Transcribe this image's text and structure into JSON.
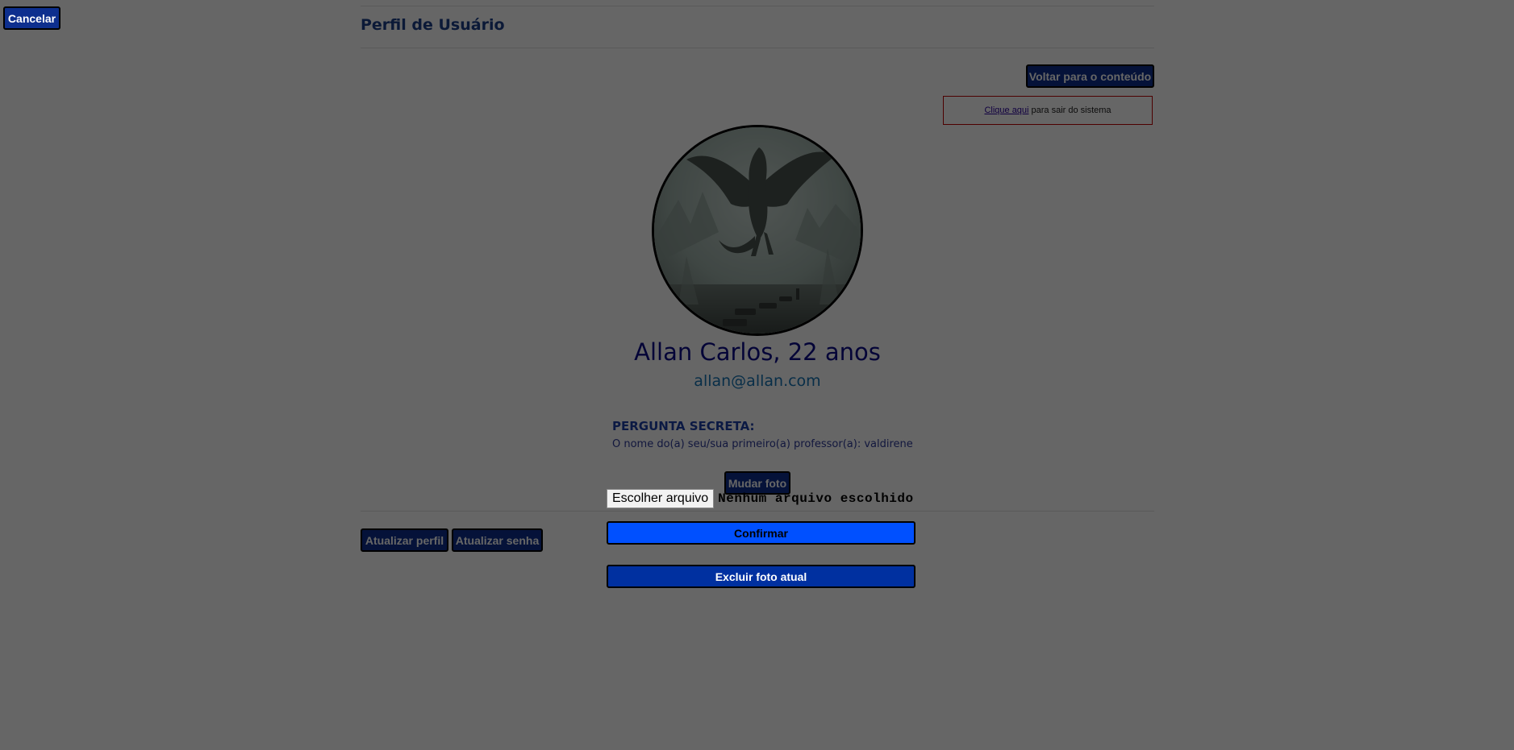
{
  "cancel_label": "Cancelar",
  "header": {
    "title": "Perfil de Usuário"
  },
  "nav": {
    "back_label": "Voltar para o conteúdo"
  },
  "logout": {
    "link_text": "Clique aqui",
    "rest_text": "para sair do sistema"
  },
  "profile": {
    "name_age": "Allan Carlos, 22 anos",
    "email": "allan@allan.com",
    "secret_question_label": "PERGUNTA SECRETA:",
    "secret_question_text": "O nome do(a) seu/sua primeiro(a) professor(a): valdirene"
  },
  "photo": {
    "change_label": "Mudar foto",
    "choose_file_label": "Escolher arquivo",
    "no_file_label": "Nenhum arquivo escolhido",
    "confirm_label": "Confirmar",
    "delete_label": "Excluir foto atual"
  },
  "actions": {
    "update_profile_label": "Atualizar perfil",
    "update_password_label": "Atualizar senha"
  },
  "colors": {
    "overlay": "rgba(0,0,0,0.6)",
    "button_dark": "#0d2f8e",
    "confirm_button": "#0050ff",
    "delete_button": "#0030a0",
    "name": "#0b0b8a",
    "email": "#1673b4"
  }
}
